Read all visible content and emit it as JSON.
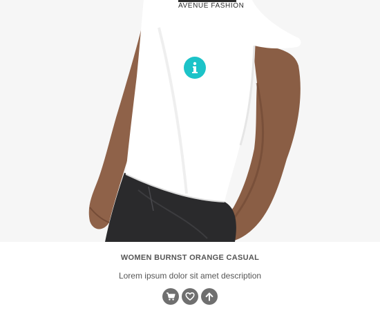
{
  "product": {
    "image_print_text": "AVENUE FASHION",
    "title": "WOMEN BURNST ORANGE CASUAL",
    "description": "Lorem ipsum dolor sit amet description"
  },
  "icons": {
    "info": "info-icon",
    "cart": "cart-icon",
    "wishlist": "heart-icon",
    "compare": "arrow-up-icon"
  },
  "colors": {
    "accent": "#1cc3c8",
    "action_button": "#6f6f6f",
    "text": "#555555"
  }
}
